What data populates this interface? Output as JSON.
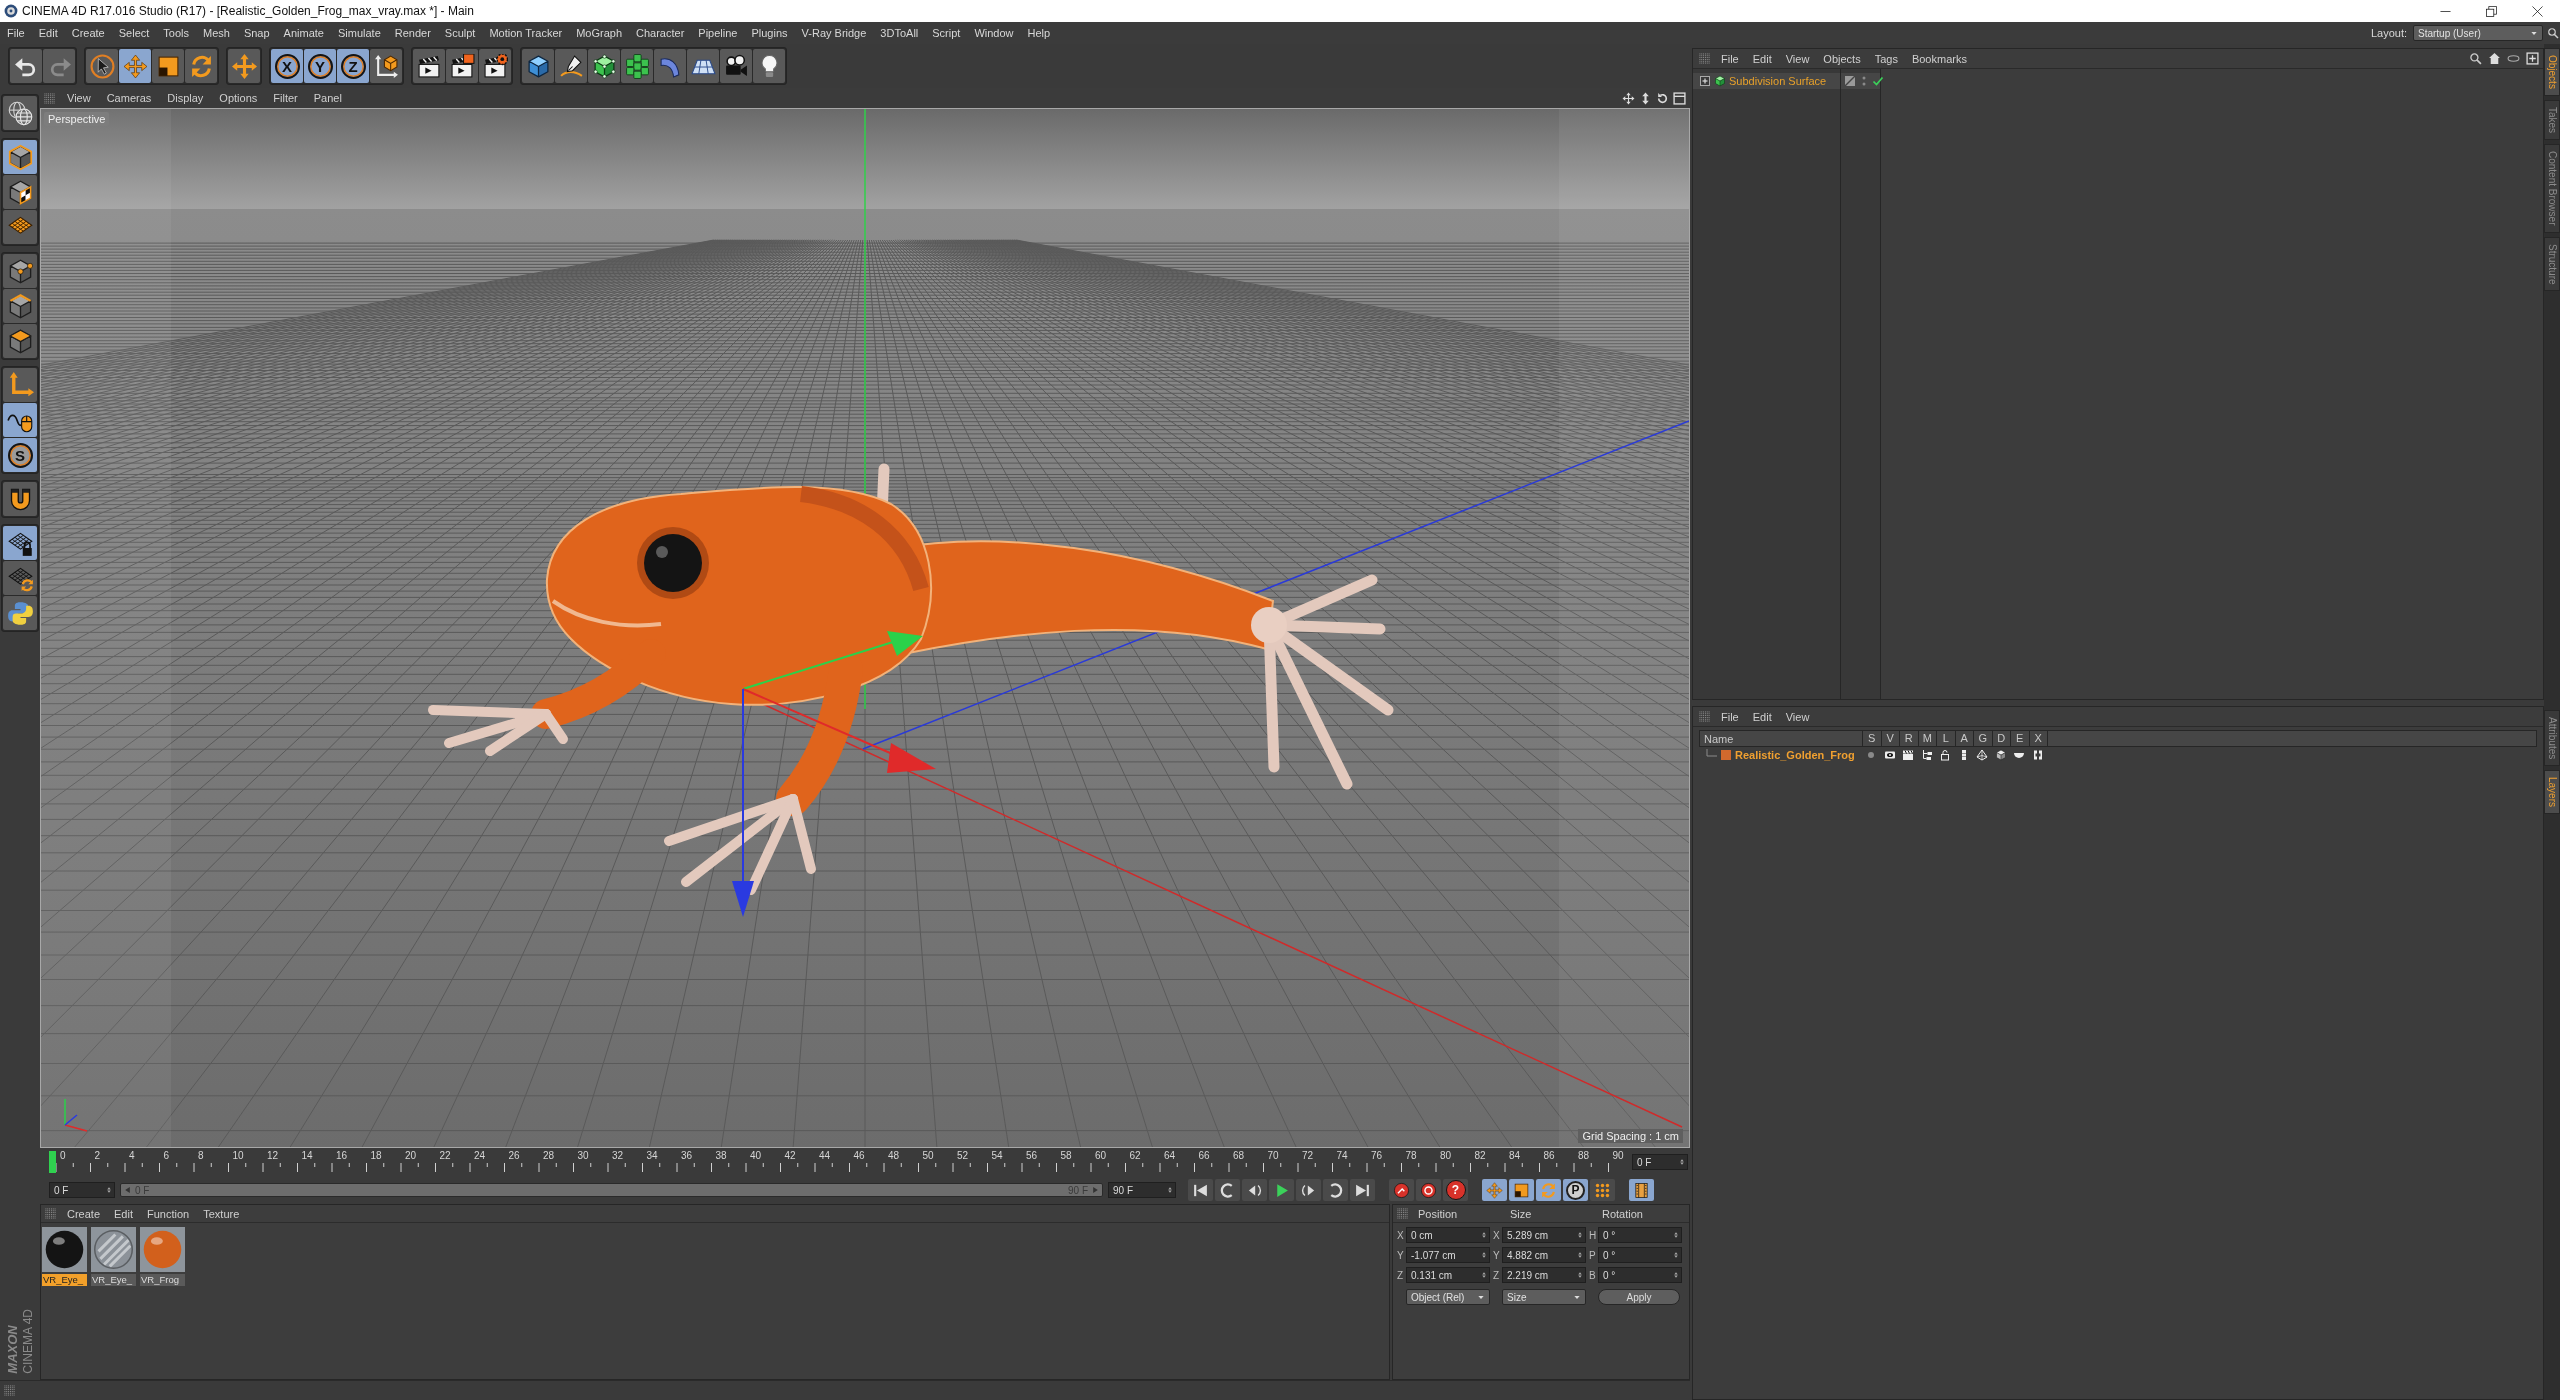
{
  "window": {
    "title": "CINEMA 4D R17.016 Studio (R17) - [Realistic_Golden_Frog_max_vray.max *] - Main"
  },
  "menu_bar": {
    "items": [
      "File",
      "Edit",
      "Create",
      "Select",
      "Tools",
      "Mesh",
      "Snap",
      "Animate",
      "Simulate",
      "Render",
      "Sculpt",
      "Motion Tracker",
      "MoGraph",
      "Character",
      "Pipeline",
      "Plugins",
      "V-Ray Bridge",
      "3DToAll",
      "Script",
      "Window",
      "Help"
    ],
    "layout_label": "Layout:",
    "layout_value": "Startup (User)"
  },
  "toolbar": [
    {
      "buttons": [
        {
          "active": false,
          "disabled": false
        },
        {
          "active": false,
          "disabled": true
        }
      ]
    },
    {
      "buttons": [
        {
          "active": false,
          "disabled": false
        },
        {
          "active": true,
          "disabled": false
        },
        {
          "active": false,
          "disabled": false
        },
        {
          "active": false,
          "disabled": false
        }
      ]
    },
    {
      "buttons": [
        {
          "active": false,
          "disabled": false
        }
      ]
    },
    {
      "buttons": [
        {
          "label": "X",
          "active": true,
          "disabled": false
        },
        {
          "label": "Y",
          "active": true,
          "disabled": false
        },
        {
          "label": "Z",
          "active": true,
          "disabled": false
        },
        {
          "active": false,
          "disabled": false
        }
      ]
    },
    {
      "buttons": [
        {
          "active": false,
          "disabled": false
        },
        {
          "active": false,
          "disabled": false
        },
        {
          "active": false,
          "disabled": false
        }
      ]
    },
    {
      "buttons": [
        {
          "active": false,
          "disabled": false
        },
        {
          "active": false,
          "disabled": false
        },
        {
          "active": false,
          "disabled": false
        },
        {
          "active": false,
          "disabled": false
        },
        {
          "active": false,
          "disabled": false
        },
        {
          "active": false,
          "disabled": false
        },
        {
          "active": false,
          "disabled": false
        },
        {
          "active": false,
          "disabled": false
        }
      ]
    }
  ],
  "mode_toolbar": [
    {
      "buttons": [
        {
          "active": false
        }
      ]
    },
    {
      "buttons": [
        {
          "active": true
        },
        {
          "active": false
        },
        {
          "active": false
        }
      ]
    },
    {
      "buttons": [
        {
          "active": false
        },
        {
          "active": false
        },
        {
          "active": false
        }
      ]
    },
    {
      "buttons": [
        {
          "active": false
        },
        {
          "active": true
        },
        {
          "label": "S",
          "active": true
        }
      ]
    },
    {
      "buttons": [
        {
          "active": false
        }
      ]
    },
    {
      "buttons": [
        {
          "active": true
        },
        {
          "active": false
        },
        {
          "active": false
        }
      ]
    }
  ],
  "viewport": {
    "menu": [
      "View",
      "Cameras",
      "Display",
      "Options",
      "Filter",
      "Panel"
    ],
    "camera": "Perspective",
    "grid_spacing": "Grid Spacing : 1 cm"
  },
  "timeline": {
    "ticks": [
      "0",
      "2",
      "4",
      "6",
      "8",
      "10",
      "12",
      "14",
      "16",
      "18",
      "20",
      "22",
      "24",
      "26",
      "28",
      "30",
      "32",
      "34",
      "36",
      "38",
      "40",
      "42",
      "44",
      "46",
      "48",
      "50",
      "52",
      "54",
      "56",
      "58",
      "60",
      "62",
      "64",
      "66",
      "68",
      "70",
      "72",
      "74",
      "76",
      "78",
      "80",
      "82",
      "84",
      "86",
      "88",
      "90"
    ],
    "playhead": {
      "level": 0
    },
    "current_frame": "0 F",
    "start_frame": "0 F",
    "range": {
      "start": "0 F",
      "end": "90 F"
    },
    "end_frame": "90 F",
    "keyframe_selection_label": "?",
    "key_filters": [
      {
        "active": true
      },
      {
        "active": true
      },
      {
        "active": true
      },
      {
        "label": "P",
        "active": true
      },
      {
        "active": false
      }
    ],
    "timeline_button": {
      "active": true
    }
  },
  "materials": {
    "menu": [
      "Create",
      "Edit",
      "Function",
      "Texture"
    ],
    "items": [
      {
        "name": "VR_Eye_",
        "selected": true,
        "kind": "solid",
        "color": "#141414"
      },
      {
        "name": "VR_Eye_",
        "selected": false,
        "kind": "glass",
        "color": "#8c9299"
      },
      {
        "name": "VR_Frog",
        "selected": false,
        "kind": "solid",
        "color": "#d2601c"
      }
    ]
  },
  "coordinates": {
    "headers": [
      "Position",
      "Size",
      "Rotation"
    ],
    "rows": [
      {
        "labels": [
          "X",
          "X",
          "H"
        ],
        "values": [
          "0 cm",
          "5.289 cm",
          "0 °"
        ]
      },
      {
        "labels": [
          "Y",
          "Y",
          "P"
        ],
        "values": [
          "-1.077 cm",
          "4.882 cm",
          "0 °"
        ]
      },
      {
        "labels": [
          "Z",
          "Z",
          "B"
        ],
        "values": [
          "0.131 cm",
          "2.219 cm",
          "0 °"
        ]
      }
    ],
    "mode": "Object (Rel)",
    "size_mode": "Size",
    "apply": "Apply"
  },
  "logo": {
    "brand": "MAXON",
    "product": "CINEMA 4D"
  },
  "object_manager": {
    "menu": [
      "File",
      "Edit",
      "View",
      "Objects",
      "Tags",
      "Bookmarks"
    ],
    "objects": [
      {
        "name": "Subdivision Surface",
        "selected": true,
        "expanded": false,
        "enabled": true
      }
    ]
  },
  "layer_manager": {
    "menu": [
      "File",
      "Edit",
      "View"
    ],
    "columns": [
      "Name",
      "S",
      "V",
      "R",
      "M",
      "L",
      "A",
      "G",
      "D",
      "E",
      "X"
    ],
    "layers": [
      {
        "name": "Realistic_Golden_Frog",
        "color": "#d2692d",
        "selected": true
      }
    ]
  },
  "side_tabs": {
    "top": [
      {
        "label": "Objects",
        "selected": true
      },
      {
        "label": "Takes",
        "selected": false
      },
      {
        "label": "Content Browser",
        "selected": false
      },
      {
        "label": "Structure",
        "selected": false
      }
    ],
    "bottom": [
      {
        "label": "Attributes",
        "selected": false
      },
      {
        "label": "Layers",
        "selected": true
      }
    ]
  }
}
